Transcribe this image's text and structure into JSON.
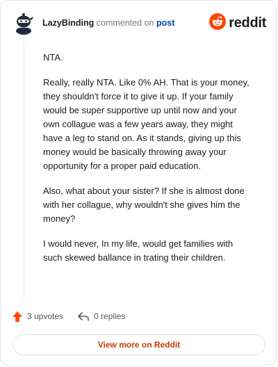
{
  "header": {
    "username": "LazyBinding",
    "action_text": "commented on",
    "post_link": "post",
    "brand_text": "reddit",
    "avatar_icon": "snoo-ninja-avatar-icon",
    "brand_icon": "reddit-logo-icon"
  },
  "comment": {
    "paragraphs": [
      "NTA.",
      "Really, really NTA. Like 0% AH. That is your money, they shouldn't force it to give it up. If your family would be super supportive up until now and your own collague was a few years away, they might have a leg to stand on. As it stands, giving up this money would be basically throwing away your opportunity for a proper paid education.",
      "Also, what about your sister? If she is almost done with her collague, why wouldn't she gives him the money?",
      "I would never, In my life, would get families with such skewed ballance in trating their children."
    ]
  },
  "footer": {
    "upvotes": "3 upvotes",
    "replies": "0 replies",
    "view_more": "View more on Reddit"
  },
  "colors": {
    "brand_orange": "#ff4500",
    "link_blue": "#0045ac",
    "cta_text": "#c73a00"
  }
}
